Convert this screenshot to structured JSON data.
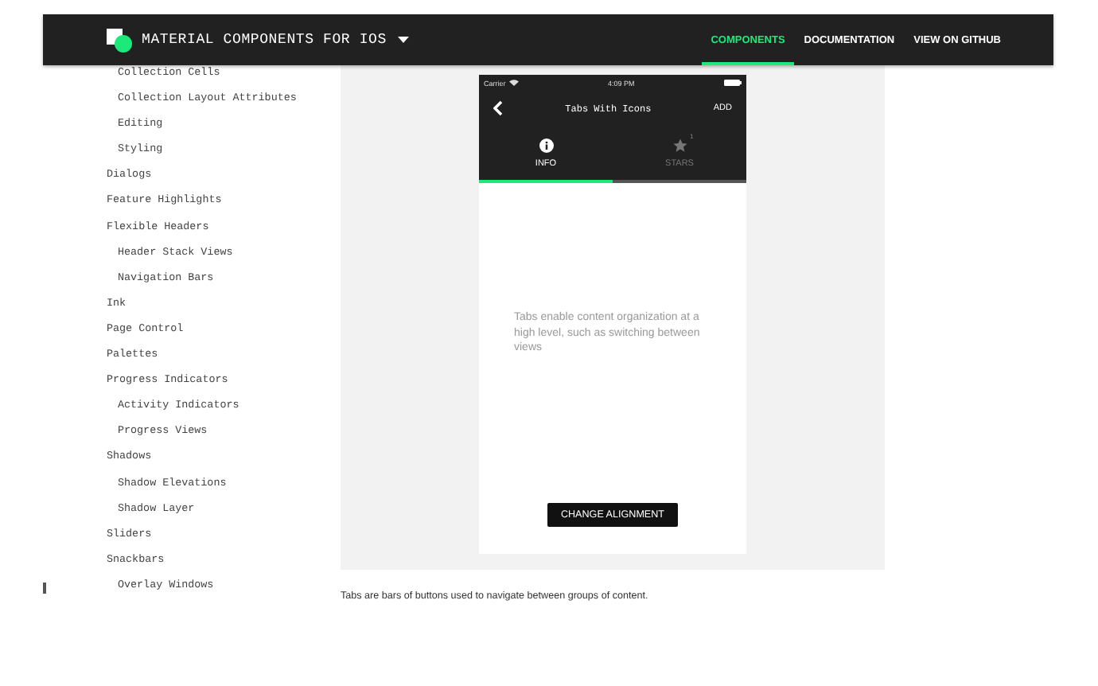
{
  "header": {
    "title": "MATERIAL COMPONENTS FOR IOS",
    "nav": [
      {
        "label": "COMPONENTS",
        "selected": true
      },
      {
        "label": "DOCUMENTATION",
        "selected": false
      },
      {
        "label": "VIEW ON GITHUB",
        "selected": false
      }
    ]
  },
  "sidebar": {
    "continued_children": [
      "Collection Cells",
      "Collection Layout Attributes",
      "Editing",
      "Styling"
    ],
    "items": [
      {
        "label": "Dialogs"
      },
      {
        "label": "Feature Highlights"
      },
      {
        "label": "Flexible Headers",
        "children": [
          {
            "label": "Header Stack Views"
          },
          {
            "label": "Navigation Bars"
          }
        ]
      },
      {
        "label": "Ink"
      },
      {
        "label": "Page Control"
      },
      {
        "label": "Palettes"
      },
      {
        "label": "Progress Indicators",
        "children": [
          {
            "label": "Activity Indicators"
          },
          {
            "label": "Progress Views"
          }
        ]
      },
      {
        "label": "Shadows",
        "children": [
          {
            "label": "Shadow Elevations"
          },
          {
            "label": "Shadow Layer"
          }
        ]
      },
      {
        "label": "Sliders"
      },
      {
        "label": "Snackbars",
        "children": [
          {
            "label": "Overlay Windows"
          }
        ]
      }
    ]
  },
  "demo": {
    "status_bar": {
      "carrier": "Carrier",
      "time": "4:09 PM"
    },
    "app_bar": {
      "title": "Tabs With Icons",
      "action": "ADD"
    },
    "tabs": [
      {
        "label": "INFO",
        "kind": "info",
        "selected": true
      },
      {
        "label": "STARS",
        "kind": "star",
        "badge": "1",
        "selected": false
      }
    ],
    "body_text": "Tabs enable content organization at a high level, such as switching between views",
    "button": "CHANGE ALIGNMENT"
  },
  "caption": "Tabs are bars of buttons used to navigate between groups of content."
}
